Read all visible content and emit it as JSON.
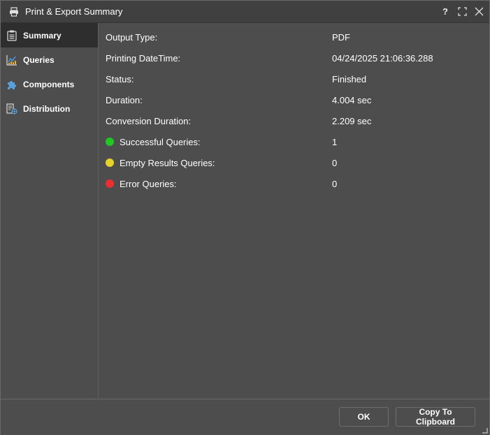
{
  "window": {
    "title": "Print & Export Summary",
    "help_label": "?"
  },
  "sidebar": {
    "items": [
      {
        "label": "Summary",
        "icon": "clipboard-icon",
        "active": true
      },
      {
        "label": "Queries",
        "icon": "chart-icon",
        "active": false
      },
      {
        "label": "Components",
        "icon": "puzzle-icon",
        "active": false
      },
      {
        "label": "Distribution",
        "icon": "distribution-icon",
        "active": false
      }
    ]
  },
  "summary": {
    "rows": [
      {
        "label": "Output Type:",
        "value": "PDF"
      },
      {
        "label": "Printing DateTime:",
        "value": "04/24/2025 21:06:36.288"
      },
      {
        "label": "Status:",
        "value": "Finished"
      },
      {
        "label": "Duration:",
        "value": "4.004 sec"
      },
      {
        "label": "Conversion Duration:",
        "value": "2.209 sec"
      },
      {
        "label": "Successful Queries:",
        "value": "1",
        "dot_color": "#22c822"
      },
      {
        "label": "Empty Results Queries:",
        "value": "0",
        "dot_color": "#e6d22a"
      },
      {
        "label": "Error Queries:",
        "value": "0",
        "dot_color": "#e83030"
      }
    ]
  },
  "footer": {
    "ok_label": "OK",
    "copy_label": "Copy To Clipboard"
  },
  "colors": {
    "background": "#4d4d4d",
    "titlebar": "#404040",
    "active_nav": "#2e2e2e"
  }
}
